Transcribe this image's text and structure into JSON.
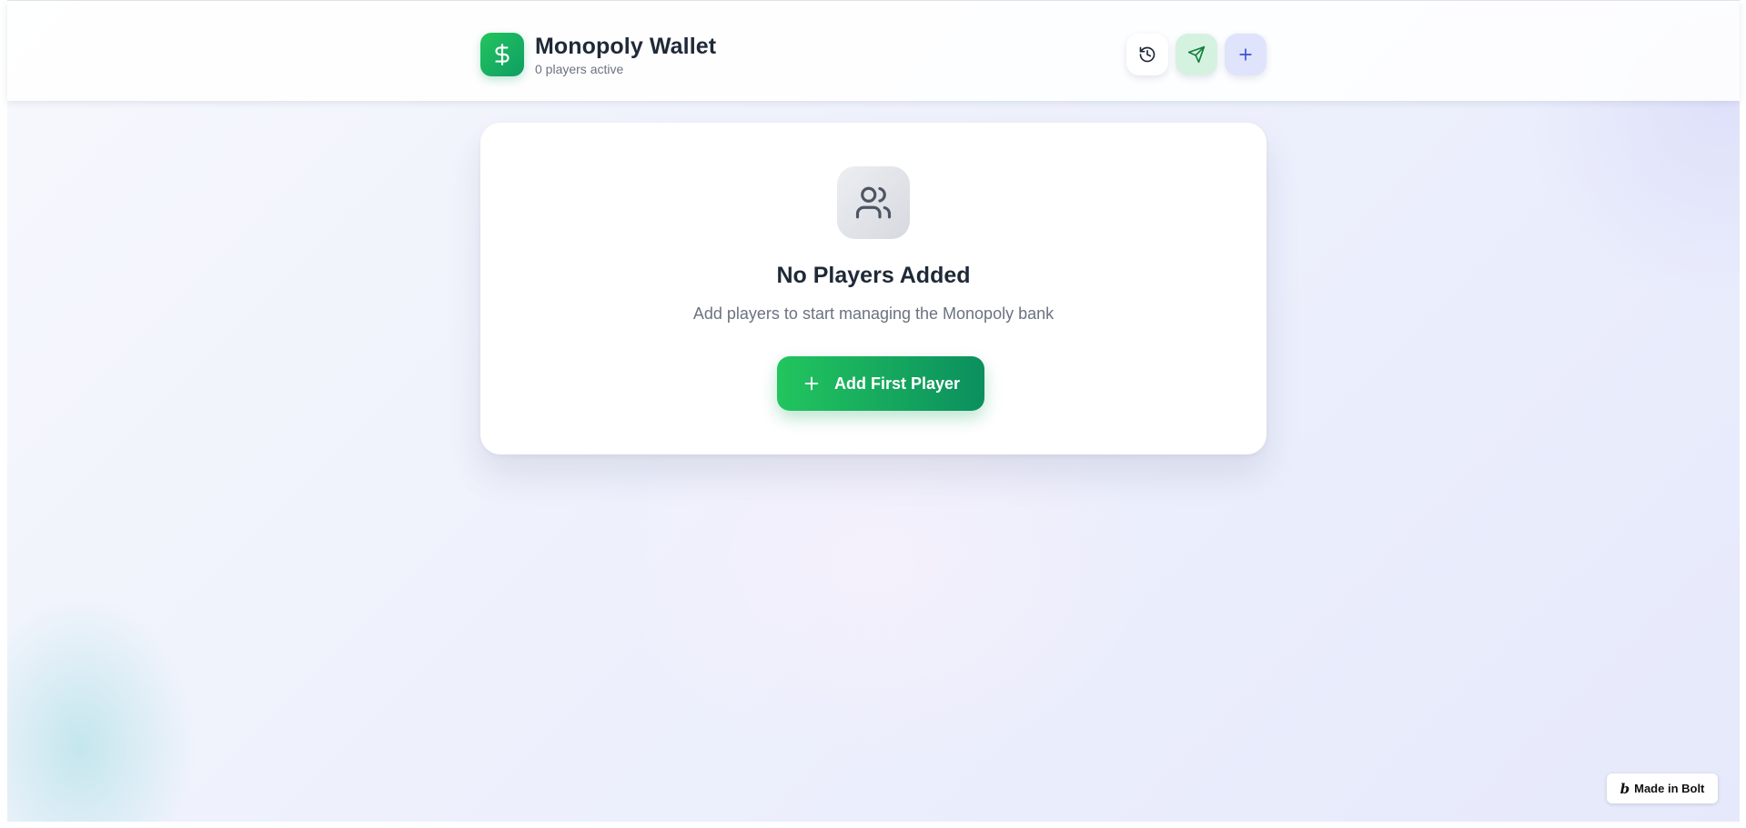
{
  "header": {
    "title": "Monopoly Wallet",
    "subtitle": "0 players active",
    "logo_icon": "dollar-sign-icon",
    "actions": [
      {
        "name": "history-button",
        "icon": "history-icon"
      },
      {
        "name": "send-money-button",
        "icon": "send-icon"
      },
      {
        "name": "add-player-button",
        "icon": "plus-icon"
      }
    ]
  },
  "empty_state": {
    "icon": "users-icon",
    "title": "No Players Added",
    "description": "Add players to start managing the Monopoly bank",
    "button_label": "Add First Player",
    "button_icon": "plus-icon"
  },
  "badge": {
    "label": "Made in Bolt",
    "icon": "bolt-logo-icon"
  },
  "colors": {
    "accent_green": "#22c55e",
    "accent_green_dark": "#0b8f5e",
    "send_button_bg": "#d5f2e1",
    "add_button_bg": "#dfe3fb",
    "title_text": "#1f2937",
    "muted_text": "#6b7280"
  }
}
